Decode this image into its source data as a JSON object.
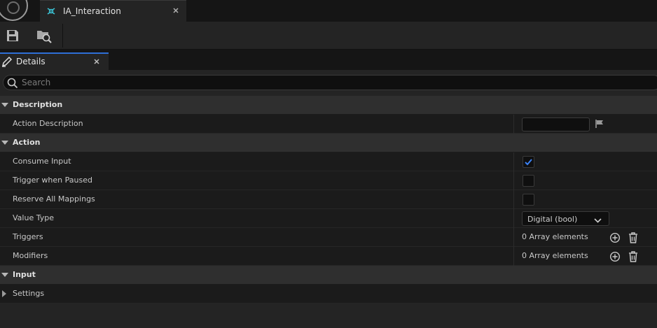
{
  "colors": {
    "accent": "#2e6fd6",
    "check": "#3b82f6",
    "panel": "#242424",
    "background": "#151515"
  },
  "window": {
    "asset_tab": {
      "title": "IA_Interaction",
      "icon": "input-action-icon",
      "close_icon": "close-icon"
    }
  },
  "toolbar": {
    "buttons": [
      {
        "icon": "save-icon"
      },
      {
        "icon": "browse-to-asset-icon"
      }
    ]
  },
  "details_panel": {
    "tab_label": "Details",
    "tab_icon": "pencil-icon",
    "search": {
      "placeholder": "Search",
      "value": ""
    },
    "categories": {
      "description": {
        "label": "Description",
        "rows": {
          "action_description": {
            "label": "Action Description",
            "value": ""
          }
        }
      },
      "action": {
        "label": "Action",
        "rows": {
          "consume_input": {
            "label": "Consume Input",
            "checked": true
          },
          "trigger_when_paused": {
            "label": "Trigger when Paused",
            "checked": false
          },
          "reserve_all_mappings": {
            "label": "Reserve All Mappings",
            "checked": false
          },
          "value_type": {
            "label": "Value Type",
            "value": "Digital (bool)"
          },
          "triggers": {
            "label": "Triggers",
            "value": "0 Array elements"
          },
          "modifiers": {
            "label": "Modifiers",
            "value": "0 Array elements"
          }
        }
      },
      "input": {
        "label": "Input",
        "rows": {
          "settings": {
            "label": "Settings",
            "expanded": false
          }
        }
      }
    }
  }
}
